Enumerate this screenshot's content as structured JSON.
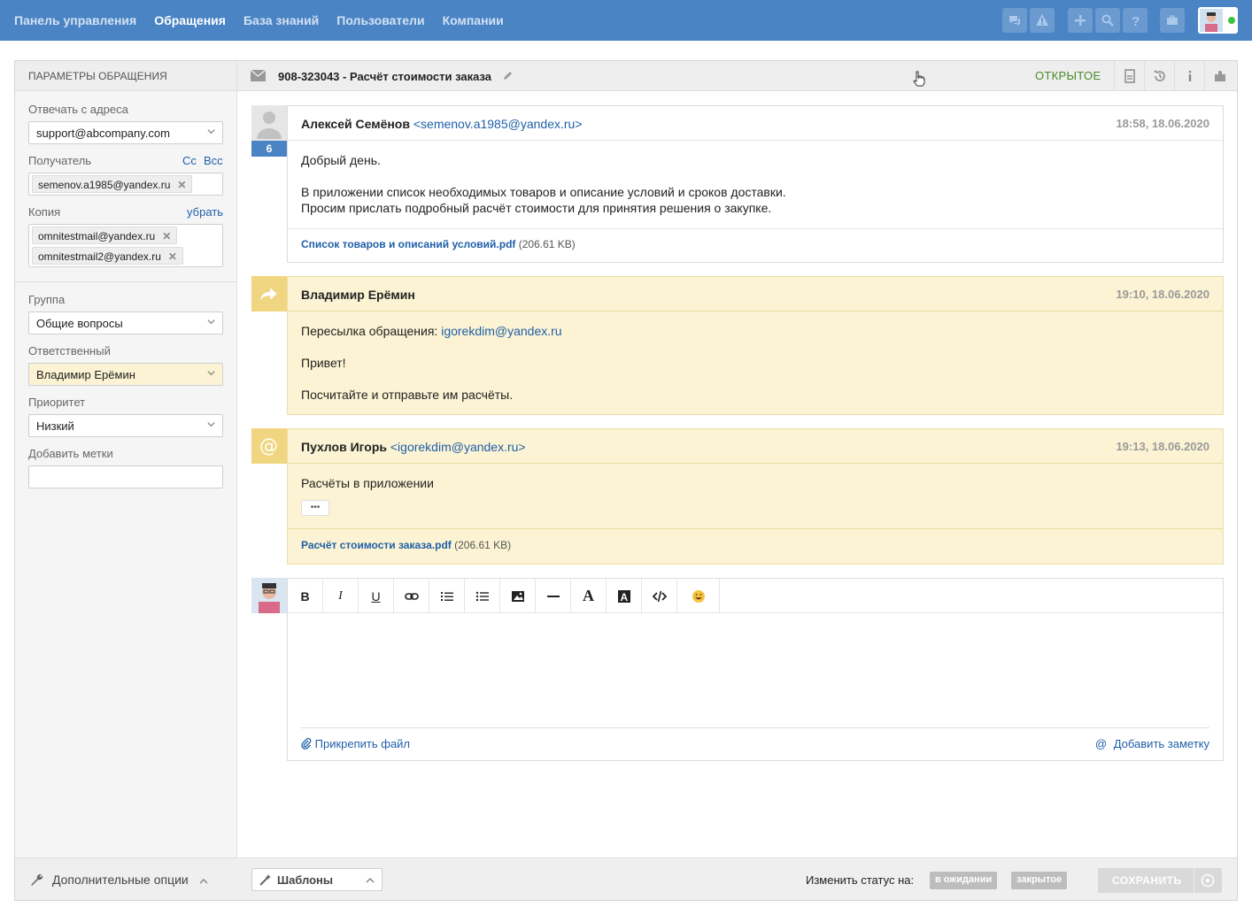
{
  "nav": {
    "items": [
      "Панель управления",
      "Обращения",
      "База знаний",
      "Пользователи",
      "Компании"
    ],
    "active": "Обращения",
    "icons": [
      "chat-icon",
      "warning-icon",
      "plus-icon",
      "search-icon",
      "help-icon",
      "briefcase-icon"
    ],
    "online_color": "#3cc23c"
  },
  "params": {
    "header": "ПАРАМЕТРЫ ОБРАЩЕНИЯ",
    "reply_from_label": "Отвечать с адреса",
    "reply_from_value": "support@abcompany.com",
    "recipient_label": "Получатель",
    "cc": "Cc",
    "bcc": "Bcc",
    "recipients": [
      "semenov.a1985@yandex.ru"
    ],
    "copy_label": "Копия",
    "copy_remove": "убрать",
    "copies": [
      "omnitestmail@yandex.ru",
      "omnitestmail2@yandex.ru"
    ],
    "group_label": "Группа",
    "group_value": "Общие вопросы",
    "assignee_label": "Ответственный",
    "assignee_value": "Владимир Ерёмин",
    "priority_label": "Приоритет",
    "priority_value": "Низкий",
    "tags_label": "Добавить метки",
    "tags_value": "",
    "more_options": "Дополнительные опции"
  },
  "ticket": {
    "title": "908-323043 - Расчёт стоимости заказа",
    "status": "ОТКРЫТОЕ",
    "status_color": "#4a8b2c"
  },
  "messages": [
    {
      "author": "Алексей Семёнов",
      "email": "<semenov.a1985@yandex.ru>",
      "time": "18:58, 18.06.2020",
      "badge": "6",
      "lines": [
        "Добрый день.",
        "В приложении список необходимых товаров и описание условий и сроков доставки.",
        "Просим прислать подробный расчёт стоимости для принятия решения о закупке."
      ],
      "attachment": "Список товаров и описаний условий.pdf",
      "attachment_size": "(206.61 KB)"
    },
    {
      "author": "Владимир Ерёмин",
      "time": "19:10, 18.06.2020",
      "forward_prefix": "Пересылка обращения:",
      "forward_email": "igorekdim@yandex.ru",
      "lines": [
        "Привет!",
        "Посчитайте и отправьте им расчёты."
      ]
    },
    {
      "author": "Пухлов Игорь",
      "email": "<igorekdim@yandex.ru>",
      "time": "19:13, 18.06.2020",
      "lines": [
        "Расчёты в приложении"
      ],
      "more": "•••",
      "attachment": "Расчёт стоимости заказа.pdf",
      "attachment_size": "(206.61 KB)"
    }
  ],
  "editor": {
    "tools": [
      "B",
      "I",
      "U",
      "link-icon",
      "ordered-list-icon",
      "bullet-list-icon",
      "image-icon",
      "rule-icon",
      "A",
      "text-bg-icon",
      "code-icon",
      "emoji-icon"
    ],
    "attach": "Прикрепить файл",
    "add_note": "Добавить заметку"
  },
  "footer": {
    "templates": "Шаблоны",
    "change_status": "Изменить статус на:",
    "pending": "в ожидании",
    "closed": "закрытое",
    "save": "СОХРАНИТЬ"
  }
}
